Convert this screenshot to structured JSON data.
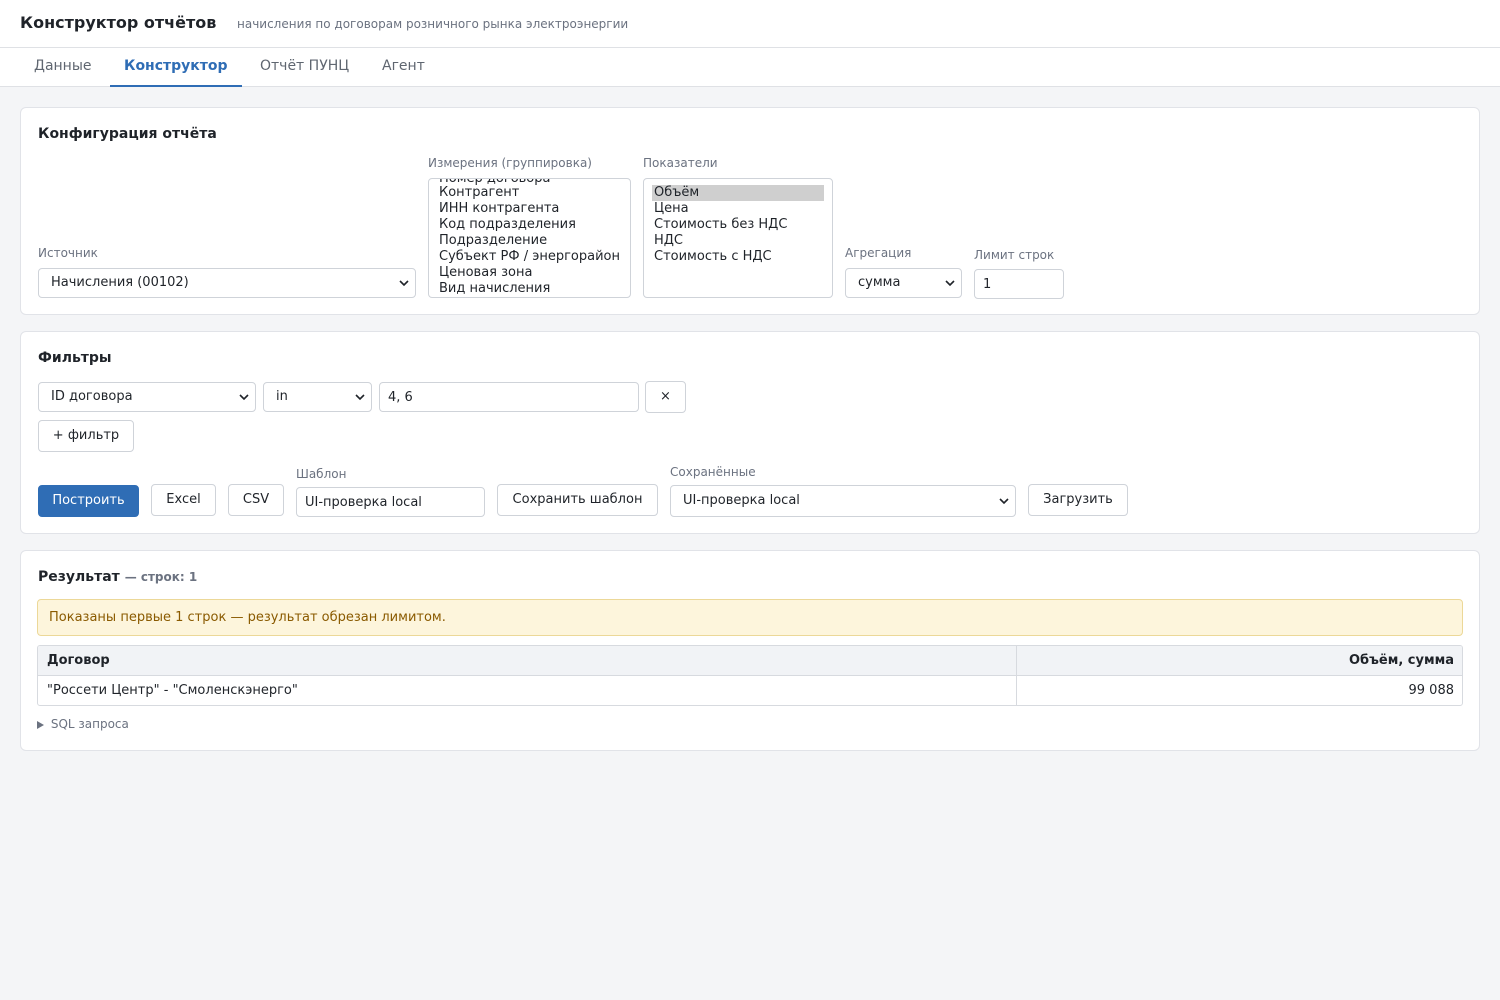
{
  "header": {
    "title": "Конструктор отчётов",
    "subtitle": "начисления по договорам розничного рынка электроэнергии"
  },
  "tabs": [
    {
      "label": "Данные"
    },
    {
      "label": "Конструктор"
    },
    {
      "label": "Отчёт ПУНЦ"
    },
    {
      "label": "Агент"
    }
  ],
  "config": {
    "title": "Конфигурация отчёта",
    "source_label": "Источник",
    "source_value": "Начисления (00102)",
    "dimensions_label": "Измерения (группировка)",
    "dimensions": [
      "Номер договора",
      "Контрагент",
      "ИНН контрагента",
      "Код подразделения",
      "Подразделение",
      "Субъект РФ / энергорайон",
      "Ценовая зона",
      "Вид начисления"
    ],
    "metrics_label": "Показатели",
    "metrics": [
      "Объём",
      "Цена",
      "Стоимость без НДС",
      "НДС",
      "Стоимость с НДС"
    ],
    "aggregation_label": "Агрегация",
    "aggregation_value": "сумма",
    "limit_label": "Лимит строк",
    "limit_value": "1"
  },
  "filters": {
    "title": "Фильтры",
    "field_value": "ID договора",
    "operator_value": "in",
    "filter_value": "4, 6",
    "remove_label": "×",
    "add_label": "+ фильтр",
    "build_label": "Построить",
    "excel_label": "Excel",
    "csv_label": "CSV",
    "template_label": "Шаблон",
    "template_value": "UI-проверка local",
    "save_template_label": "Сохранить шаблон",
    "saved_label": "Сохранённые",
    "saved_value": "UI-проверка local",
    "load_label": "Загрузить"
  },
  "result": {
    "title": "Результат",
    "count": "— строк: 1",
    "notice": "Показаны первые 1 строк — результат обрезан лимитом.",
    "columns": [
      "Договор",
      "Объём, сумма"
    ],
    "rows": [
      [
        "\"Россети Центр\" - \"Смоленскэнерго\"",
        "99 088"
      ]
    ],
    "sql_label": "SQL запроса"
  },
  "colors": {
    "accent": "#2f6db5",
    "notice_bg": "#fdf5dc",
    "notice_text": "#8a5a00"
  }
}
